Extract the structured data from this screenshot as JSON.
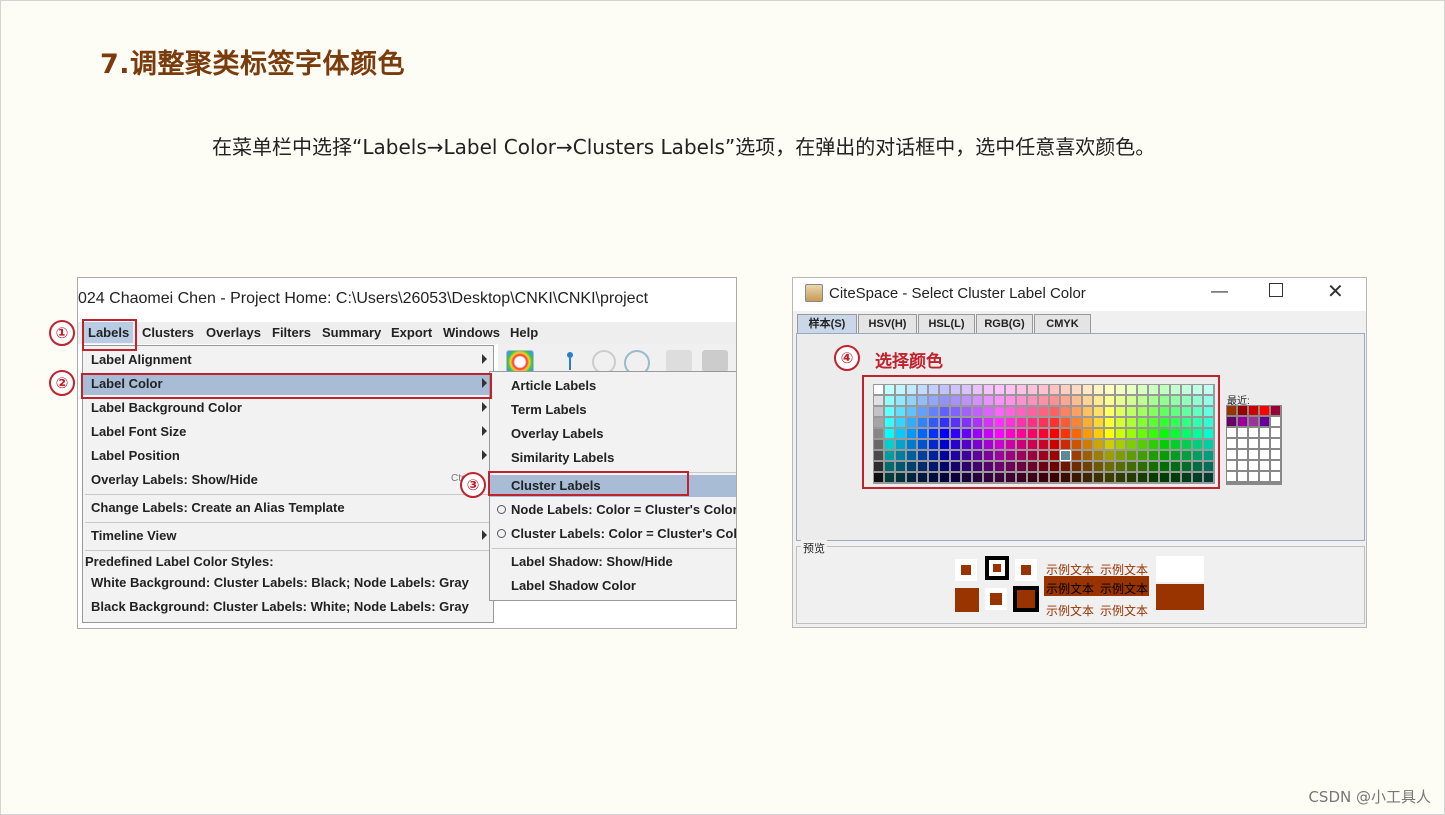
{
  "slide": {
    "title": "7.调整聚类标签字体颜色",
    "description": "在菜单栏中选择“Labels→Label Color→Clusters Labels”选项，在弹出的对话框中，选中任意喜欢颜色。",
    "watermark": "CSDN @小工具人"
  },
  "left_window": {
    "title": "024 Chaomei Chen - Project Home: C:\\Users\\26053\\Desktop\\CNKI\\CNKI\\project",
    "menubar": [
      "Labels",
      "Clusters",
      "Overlays",
      "Filters",
      "Summary",
      "Export",
      "Windows",
      "Help"
    ],
    "labels_menu": {
      "label_alignment": "Label Alignment",
      "label_color": "Label Color",
      "label_background_color": "Label Background Color",
      "label_font_size": "Label Font Size",
      "label_position": "Label Position",
      "overlay_labels": "Overlay Labels: Show/Hide",
      "overlay_shortcut": "Ctr",
      "change_labels": "Change Labels: Create an Alias Template",
      "timeline_view": "Timeline View",
      "predefined_header": "Predefined Label Color Styles:",
      "white_bg": "White Background: Cluster Labels: Black; Node Labels: Gray",
      "black_bg": "Black Background: Cluster Labels: White; Node Labels: Gray"
    },
    "color_submenu": {
      "article": "Article Labels",
      "term": "Term Labels",
      "overlay": "Overlay Labels",
      "similarity": "Similarity Labels",
      "cluster": "Cluster Labels",
      "node_cluster_color": "Node Labels: Color = Cluster's Color",
      "cluster_cluster_color": "Cluster Labels: Color = Cluster's Color",
      "shadow_toggle": "Label Shadow: Show/Hide",
      "shadow_color": "Label Shadow Color"
    },
    "steps": [
      "①",
      "②",
      "③"
    ]
  },
  "dialog": {
    "title": "CiteSpace - Select Cluster Label Color",
    "tabs": [
      "样本(S)",
      "HSV(H)",
      "HSL(L)",
      "RGB(G)",
      "CMYK"
    ],
    "step": "④",
    "choose_label": "选择颜色",
    "recent_label": "最近:",
    "preview_label": "预览",
    "sample_text": "示例文本",
    "selected_color": "#993300",
    "recent_colors": [
      "#993300",
      "#990000",
      "#cc0000",
      "#ff0000",
      "#990033",
      "#660066",
      "#990099",
      "#993399",
      "#660099"
    ]
  }
}
